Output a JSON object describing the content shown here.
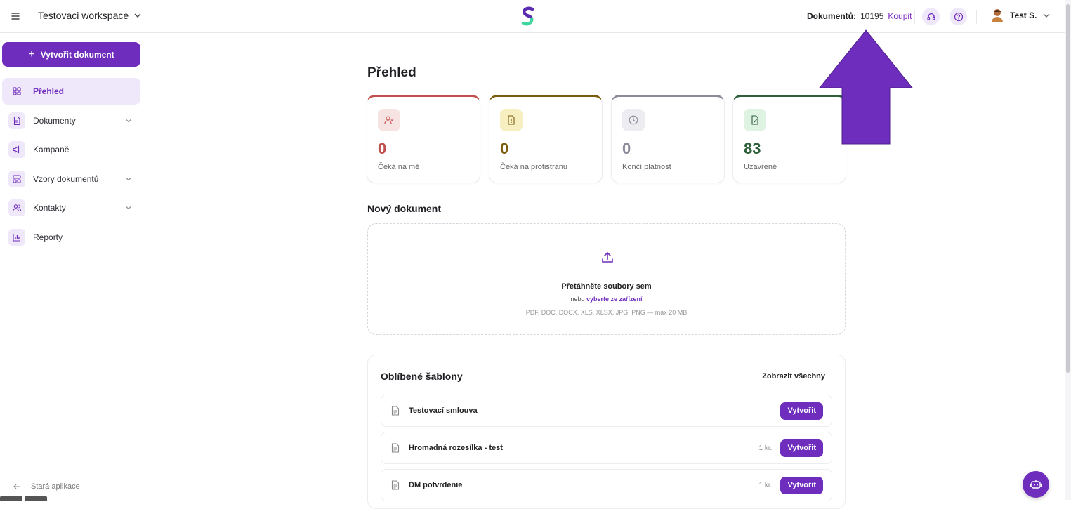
{
  "header": {
    "workspace_name": "Testovaci workspace",
    "doc_count_label": "Dokumentů:",
    "doc_count_value": "10195",
    "buy_link": "Koupit",
    "user_name": "Test S."
  },
  "sidebar": {
    "create_button": "Vytvořit dokument",
    "items": [
      {
        "label": "Přehled",
        "icon": "dashboard-icon"
      },
      {
        "label": "Dokumenty",
        "icon": "document-icon"
      },
      {
        "label": "Kampaně",
        "icon": "megaphone-icon"
      },
      {
        "label": "Vzory dokumentů",
        "icon": "template-icon"
      },
      {
        "label": "Kontakty",
        "icon": "users-icon"
      },
      {
        "label": "Reporty",
        "icon": "chart-icon"
      }
    ],
    "old_app": "Stará aplikace"
  },
  "main": {
    "title": "Přehled",
    "stats": [
      {
        "value": "0",
        "label": "Čeká na mě",
        "color": "#c0504d",
        "icon": "user-check-icon"
      },
      {
        "value": "0",
        "label": "Čeká na protistranu",
        "color": "#7a5c0f",
        "icon": "document-alert-icon"
      },
      {
        "value": "0",
        "label": "Končí platnost",
        "color": "#8a8a99",
        "icon": "clock-icon"
      },
      {
        "value": "83",
        "label": "Uzavřené",
        "color": "#2e5e3a",
        "icon": "document-check-icon"
      }
    ],
    "new_document": {
      "title": "Nový dokument",
      "drop_title": "Přetáhněte soubory sem",
      "drop_or": "nebo",
      "drop_link": "vyberte ze zařízení",
      "drop_formats": "PDF, DOC, DOCX, XLS, XLSX, JPG, PNG — max 20 MB"
    },
    "favorites": {
      "title": "Oblíbené šablony",
      "show_all": "Zobrazit všechny",
      "items": [
        {
          "name": "Testovací smlouva",
          "count": "",
          "button": "Vytvořit"
        },
        {
          "name": "Hromadná rozesílka - test",
          "count": "1 kr.",
          "button": "Vytvořit"
        },
        {
          "name": "DM potvrdenie",
          "count": "1 kr.",
          "button": "Vytvořit"
        }
      ]
    }
  },
  "colors": {
    "accent": "#6f2dbd",
    "accent_light": "#efe7fa",
    "annotation_arrow": "#6f2dbd"
  }
}
